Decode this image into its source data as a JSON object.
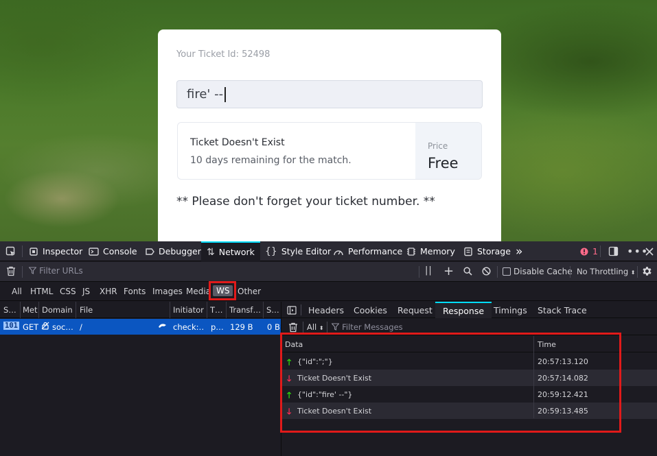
{
  "page": {
    "ticket_id_label": "Your Ticket Id: 52498",
    "input_value": "fire' --",
    "result_title": "Ticket Doesn't Exist",
    "result_subtitle": "10 days remaining for the match.",
    "price_label": "Price",
    "price_value": "Free",
    "reminder": "** Please don't forget your ticket number. **"
  },
  "devtools": {
    "tabs": [
      "Inspector",
      "Console",
      "Debugger",
      "Network",
      "Style Editor",
      "Performance",
      "Memory",
      "Storage"
    ],
    "active_tab": "Network",
    "more_tabs": "»",
    "error_count": "1",
    "toolbar": {
      "filter_placeholder": "Filter URLs",
      "pause_label": "||",
      "disable_cache": "Disable Cache",
      "throttling": "No Throttling"
    },
    "types": [
      "All",
      "HTML",
      "CSS",
      "JS",
      "XHR",
      "Fonts",
      "Images",
      "Media",
      "WS",
      "Other"
    ],
    "active_type": "WS",
    "request_columns": [
      "S…",
      "Met",
      "Domain",
      "File",
      "Initiator",
      "T…",
      "Transf…",
      "S…"
    ],
    "request": {
      "status": "101",
      "method": "GET",
      "domain": "soc…",
      "file": "/",
      "initiator": "check:…",
      "type": "p…",
      "transferred": "129 B",
      "size": "0 B"
    },
    "detail_tabs": [
      "Headers",
      "Cookies",
      "Request",
      "Response",
      "Timings",
      "Stack Trace"
    ],
    "active_detail_tab": "Response",
    "message_filter_type": "All",
    "message_filter_placeholder": "Filter Messages",
    "message_columns": [
      "Data",
      "Time"
    ],
    "messages": [
      {
        "direction": "sent",
        "data": "{\"id\":\";\"}",
        "time": "20:57:13.120"
      },
      {
        "direction": "received",
        "data": "Ticket Doesn't Exist",
        "time": "20:57:14.082"
      },
      {
        "direction": "sent",
        "data": "{\"id\":\"fire' --\"}",
        "time": "20:59:12.421"
      },
      {
        "direction": "received",
        "data": "Ticket Doesn't Exist",
        "time": "20:59:13.485"
      }
    ],
    "colors": {
      "accent": "#00ddff",
      "selected_row": "#0b56c1",
      "highlight": "#e11a1a",
      "sent_arrow": "#30e60b",
      "received_arrow": "#ff2d55"
    }
  }
}
